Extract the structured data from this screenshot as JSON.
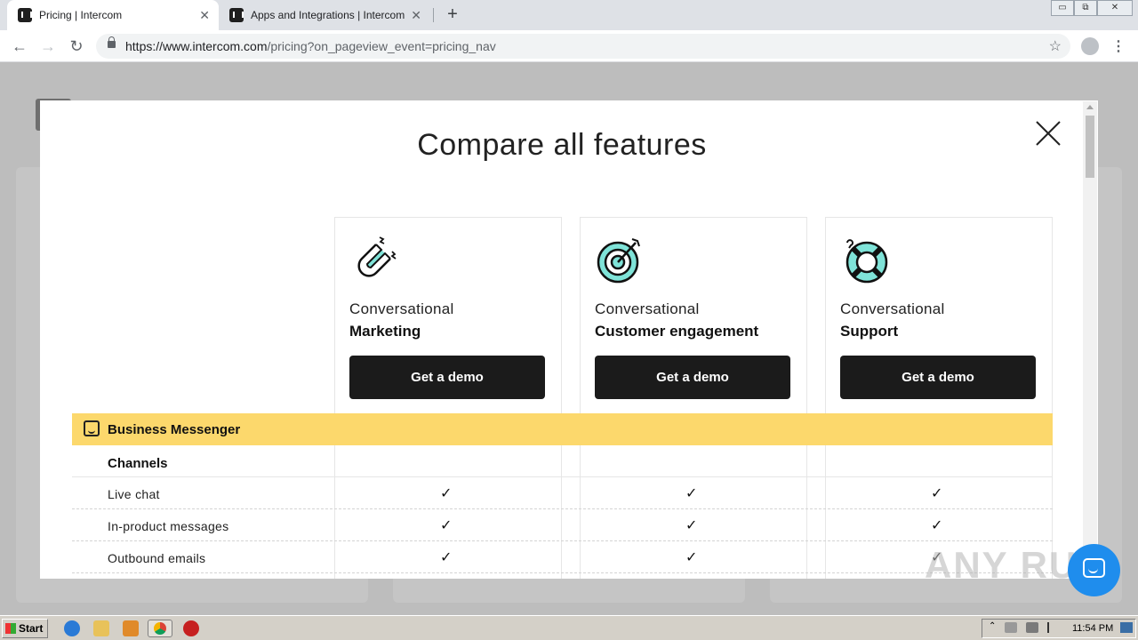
{
  "browser": {
    "tabs": [
      {
        "title": "Pricing | Intercom",
        "close": "✕"
      },
      {
        "title": "Apps and Integrations | Intercom",
        "close": "✕"
      }
    ],
    "new_tab": "+",
    "url_host": "https://www.intercom.com",
    "url_path": "/pricing?on_pageview_event=pricing_nav",
    "back": "←",
    "forward": "→",
    "reload": "↻",
    "star": "☆",
    "menu": "⋮",
    "window_controls": {
      "minimize": "▭",
      "restore": "⧉",
      "close": "✕"
    }
  },
  "modal": {
    "title": "Compare all features",
    "close_icon": "close-icon",
    "plans": [
      {
        "icon": "magnet-icon",
        "light": "Conversational",
        "bold": "Marketing",
        "button": "Get a demo"
      },
      {
        "icon": "target-icon",
        "light": "Conversational",
        "bold": "Customer engagement",
        "button": "Get a demo"
      },
      {
        "icon": "lifebuoy-icon",
        "light": "Conversational",
        "bold": "Support",
        "button": "Get a demo"
      }
    ],
    "section": {
      "icon": "messenger-icon",
      "label": "Business Messenger"
    },
    "group": "Channels",
    "features": [
      {
        "label": "Live chat",
        "marks": [
          "✓",
          "✓",
          "✓"
        ]
      },
      {
        "label": "In-product messages",
        "marks": [
          "✓",
          "✓",
          "✓"
        ]
      },
      {
        "label": "Outbound emails",
        "marks": [
          "✓",
          "✓",
          "✓"
        ]
      }
    ]
  },
  "colors": {
    "accent_yellow": "#fcd86c",
    "button_dark": "#1b1b1b",
    "chat_blue": "#1f8ded",
    "icon_teal": "#7fe3d8"
  },
  "watermark": "ANY RUN",
  "taskbar": {
    "start": "Start",
    "clock": "11:54 PM"
  }
}
